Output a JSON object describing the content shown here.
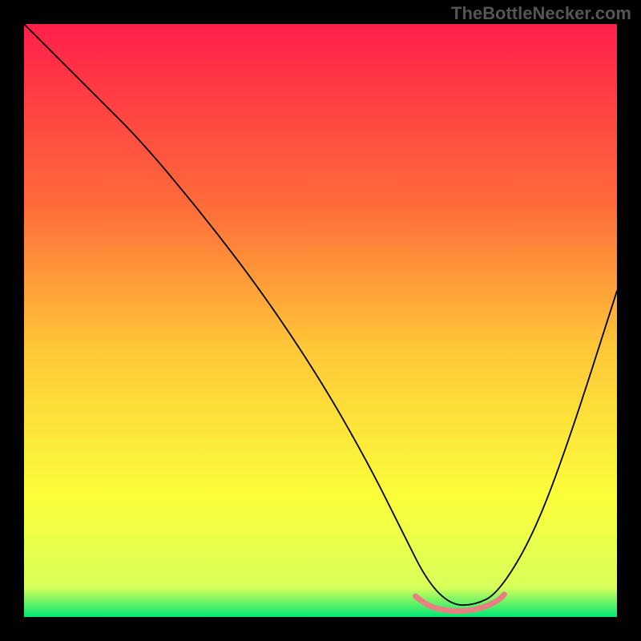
{
  "watermark": "TheBottleNecker.com",
  "chart_data": {
    "type": "line",
    "title": "",
    "xlabel": "",
    "ylabel": "",
    "xlim": [
      0,
      100
    ],
    "ylim": [
      0,
      100
    ],
    "gradient_stops": [
      {
        "offset": 0,
        "color": "#ff1f4a"
      },
      {
        "offset": 30,
        "color": "#ff6a3a"
      },
      {
        "offset": 55,
        "color": "#ffc838"
      },
      {
        "offset": 80,
        "color": "#fbff3a"
      },
      {
        "offset": 95,
        "color": "#d8ff5a"
      },
      {
        "offset": 100,
        "color": "#00e874"
      }
    ],
    "series": [
      {
        "name": "bottleneck-curve",
        "color": "#000000",
        "x": [
          0,
          4,
          8,
          12,
          20,
          30,
          40,
          50,
          58,
          64,
          68,
          72,
          76,
          80,
          86,
          92,
          100
        ],
        "y": [
          100,
          96,
          92,
          88,
          80,
          68,
          55,
          40,
          26,
          14,
          6,
          2,
          2,
          4,
          14,
          30,
          55
        ]
      },
      {
        "name": "optimal-zone",
        "color": "#e98080",
        "width": 7,
        "x": [
          66,
          68,
          70,
          72,
          74,
          76,
          78,
          80,
          81
        ],
        "y": [
          3.5,
          2.0,
          1.3,
          1.0,
          1.0,
          1.2,
          1.8,
          2.8,
          3.8
        ]
      }
    ]
  }
}
